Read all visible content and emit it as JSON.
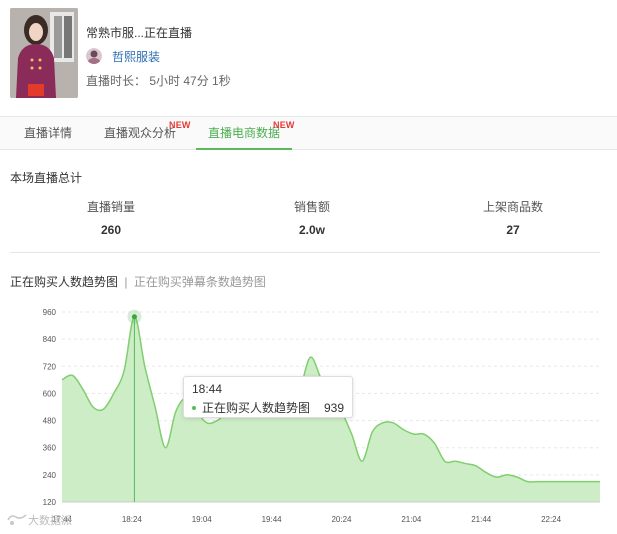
{
  "header": {
    "title": "常熟市服...正在直播",
    "shop_name": "哲熙服装",
    "duration_label": "直播时长：",
    "duration_value": "5小时 47分 1秒"
  },
  "tabs": [
    {
      "label": "直播详情",
      "badge": ""
    },
    {
      "label": "直播观众分析",
      "badge": "NEW"
    },
    {
      "label": "直播电商数据",
      "badge": "NEW",
      "active": true
    }
  ],
  "summary": {
    "title": "本场直播总计",
    "metrics": [
      {
        "label": "直播销量",
        "value": "260"
      },
      {
        "label": "销售额",
        "value": "2.0w"
      },
      {
        "label": "上架商品数",
        "value": "27"
      }
    ]
  },
  "chart_tabs": {
    "active": "正在购买人数趋势图",
    "separator": "|",
    "inactive": "正在购买弹幕条数趋势图"
  },
  "chart_data": {
    "type": "area",
    "x": [
      "18:04",
      "18:10",
      "18:18",
      "18:24",
      "18:30",
      "18:36",
      "18:42",
      "18:44",
      "18:48",
      "18:54",
      "19:00",
      "19:04",
      "19:10",
      "19:16",
      "19:22",
      "19:28",
      "19:34",
      "19:40",
      "19:44",
      "19:50",
      "19:56",
      "20:02",
      "20:08",
      "20:12",
      "20:18",
      "20:24",
      "20:28",
      "20:34",
      "20:38",
      "20:42",
      "20:48",
      "20:52",
      "20:58",
      "21:02",
      "21:08",
      "21:14",
      "21:20",
      "21:26",
      "21:32",
      "21:38",
      "21:44",
      "21:50",
      "21:56",
      "22:02",
      "22:08",
      "22:14",
      "22:20",
      "22:26",
      "22:32",
      "22:38",
      "22:44",
      "22:50",
      "22:56"
    ],
    "values": [
      660,
      680,
      620,
      540,
      530,
      600,
      700,
      939,
      720,
      540,
      360,
      520,
      580,
      520,
      470,
      480,
      520,
      560,
      610,
      640,
      580,
      520,
      560,
      620,
      760,
      670,
      580,
      520,
      420,
      300,
      430,
      470,
      470,
      440,
      420,
      420,
      380,
      300,
      300,
      290,
      280,
      250,
      230,
      240,
      230,
      210,
      210,
      210,
      210,
      210,
      210,
      210,
      210
    ],
    "y_ticks": [
      "120",
      "240",
      "360",
      "480",
      "600",
      "720",
      "840",
      "960"
    ],
    "x_ticks": [
      "17:44",
      "18:24",
      "19:04",
      "19:44",
      "20:24",
      "21:04",
      "21:44",
      "22:24"
    ],
    "ylim": [
      120,
      960
    ],
    "series_name": "正在购买人数趋势图",
    "fill_color": "#c8ebc0",
    "line_color": "#7fcf6e",
    "grid": true,
    "highlight": {
      "time": "18:44",
      "value": 939
    }
  },
  "tooltip": {
    "time": "18:44",
    "series": "正在购买人数趋势图",
    "value": "939"
  },
  "watermark": "大数据派"
}
